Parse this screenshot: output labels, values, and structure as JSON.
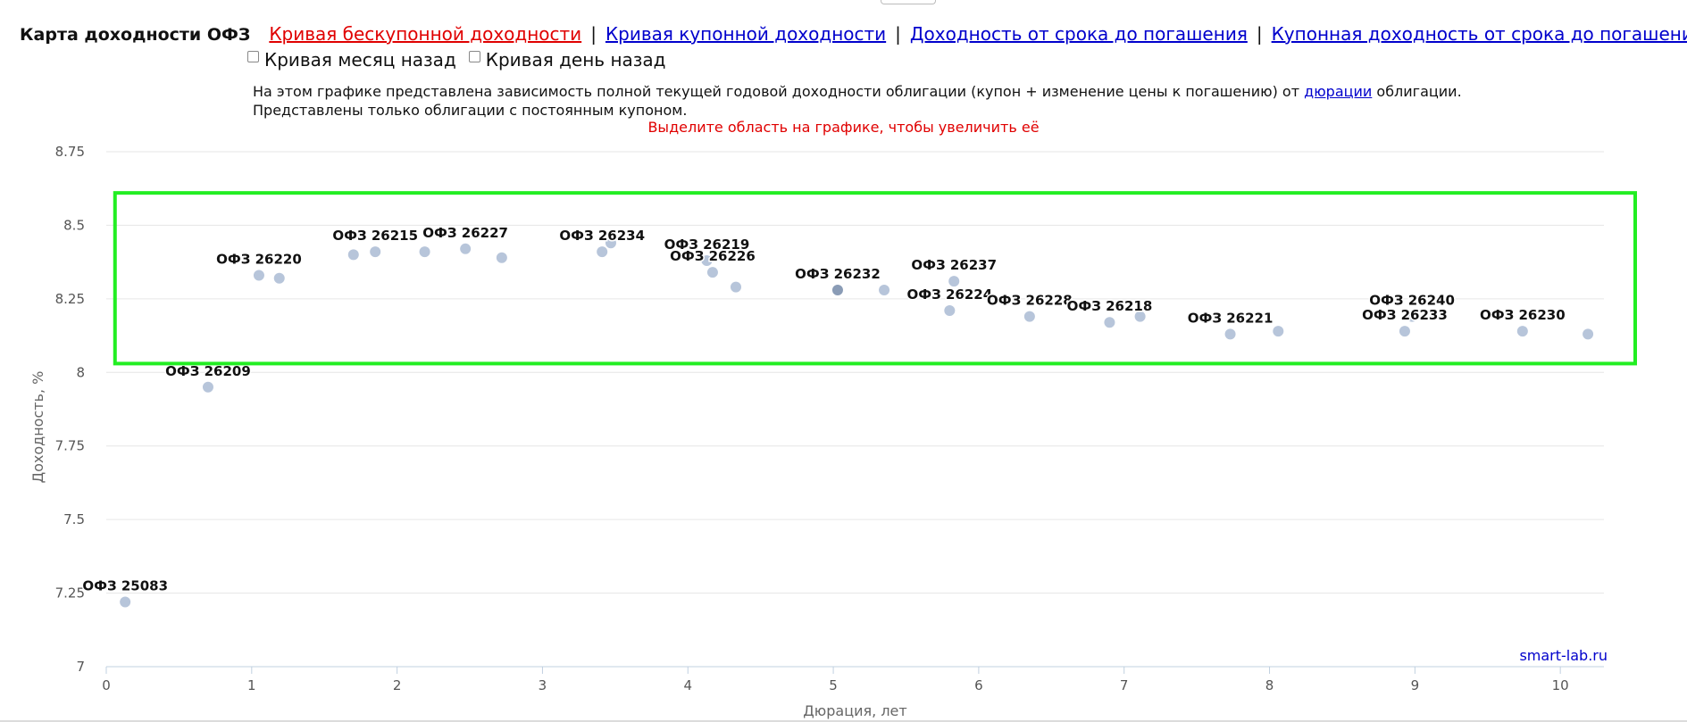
{
  "header": {
    "title": "Карта доходности ОФЗ",
    "links": [
      {
        "label": "Кривая бескупонной доходности",
        "active": true
      },
      {
        "label": "Кривая купонной доходности",
        "active": false
      },
      {
        "label": "Доходность от срока до погашения",
        "active": false
      },
      {
        "label": "Купонная доходность от срока до погашения",
        "active": false
      }
    ],
    "separator": "|"
  },
  "checkboxes": [
    {
      "label": "Кривая месяц назад",
      "checked": false
    },
    {
      "label": "Кривая день назад",
      "checked": false
    }
  ],
  "description": {
    "line1_before": "На этом графике представлена зависимость полной текущей годовой доходности облигации (купон + изменение цены к погашению) от ",
    "link": "дюрации",
    "line1_after": " облигации.",
    "line2": "Представлены только облигации с постоянным купоном."
  },
  "hint": "Выделите область на графике, чтобы увеличить её",
  "credit": "smart-lab.ru",
  "colors": {
    "point": "#b7c5da",
    "point_highlight": "#8a9cb6",
    "selection": "#22ee22",
    "grid": "#e6e6e6",
    "link": "#0000cc",
    "active_link": "#e00000"
  },
  "chart_data": {
    "type": "scatter",
    "xlabel": "Дюрация, лет",
    "ylabel": "Доходность, %",
    "xlim": [
      0,
      10.3
    ],
    "ylim": [
      7,
      8.75
    ],
    "xticks": [
      0,
      1,
      2,
      3,
      4,
      5,
      6,
      7,
      8,
      9,
      10
    ],
    "yticks": [
      7,
      7.25,
      7.5,
      7.75,
      8,
      8.25,
      8.5,
      8.75
    ],
    "ytick_labels": [
      "7",
      "7.25",
      "7.5",
      "7.75",
      "8",
      "8.25",
      "8.5",
      "8.75"
    ],
    "grid": true,
    "selection_region": {
      "x": [
        0.06,
        10.3
      ],
      "y": [
        8.03,
        8.61
      ]
    },
    "points": [
      {
        "x": 0.13,
        "y": 7.22,
        "label": "ОФЗ 25083"
      },
      {
        "x": 0.7,
        "y": 7.95,
        "label": "ОФЗ 26209"
      },
      {
        "x": 1.05,
        "y": 8.33,
        "label": "ОФЗ 26220"
      },
      {
        "x": 1.19,
        "y": 8.32,
        "label": ""
      },
      {
        "x": 1.7,
        "y": 8.4,
        "label": ""
      },
      {
        "x": 1.85,
        "y": 8.41,
        "label": "ОФЗ 26215"
      },
      {
        "x": 2.19,
        "y": 8.41,
        "label": ""
      },
      {
        "x": 2.47,
        "y": 8.42,
        "label": "ОФЗ 26227"
      },
      {
        "x": 2.72,
        "y": 8.39,
        "label": ""
      },
      {
        "x": 3.41,
        "y": 8.41,
        "label": "ОФЗ 26234"
      },
      {
        "x": 3.47,
        "y": 8.44,
        "label": ""
      },
      {
        "x": 4.13,
        "y": 8.38,
        "label": "ОФЗ 26219"
      },
      {
        "x": 4.17,
        "y": 8.34,
        "label": "ОФЗ 26226"
      },
      {
        "x": 4.33,
        "y": 8.29,
        "label": ""
      },
      {
        "x": 5.03,
        "y": 8.28,
        "label": "ОФЗ 26232",
        "highlight": true
      },
      {
        "x": 5.35,
        "y": 8.28,
        "label": ""
      },
      {
        "x": 5.83,
        "y": 8.31,
        "label": "ОФЗ 26237"
      },
      {
        "x": 5.8,
        "y": 8.21,
        "label": "ОФЗ 26224"
      },
      {
        "x": 6.35,
        "y": 8.19,
        "label": "ОФЗ 26228"
      },
      {
        "x": 6.9,
        "y": 8.17,
        "label": "ОФЗ 26218"
      },
      {
        "x": 7.11,
        "y": 8.19,
        "label": ""
      },
      {
        "x": 7.73,
        "y": 8.13,
        "label": "ОФЗ 26221"
      },
      {
        "x": 8.06,
        "y": 8.14,
        "label": ""
      },
      {
        "x": 8.93,
        "y": 8.14,
        "label": "ОФЗ 26233"
      },
      {
        "x": 8.98,
        "y": 8.19,
        "label": "ОФЗ 26240"
      },
      {
        "x": 9.74,
        "y": 8.14,
        "label": "ОФЗ 26230"
      },
      {
        "x": 10.19,
        "y": 8.13,
        "label": ""
      }
    ]
  }
}
